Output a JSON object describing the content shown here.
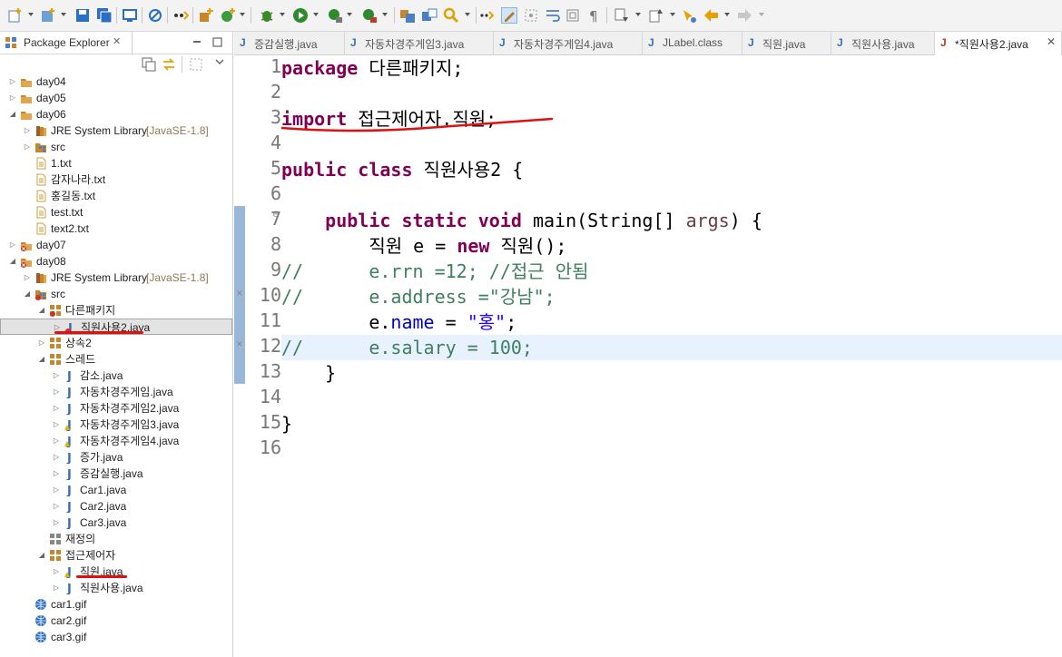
{
  "colors": {
    "keyword": "#7f0055",
    "comment": "#3f7f5f",
    "string": "#2a00ff",
    "field": "#0000c0",
    "annotation": "#e01010",
    "current_line": "#e8f2fe"
  },
  "explorer": {
    "title": "Package Explorer",
    "close": "✕",
    "tree": [
      {
        "label": "day04",
        "icon": "project-icon"
      },
      {
        "label": "day05",
        "icon": "project-icon"
      },
      {
        "label": "day06",
        "icon": "project-icon"
      },
      {
        "label": "JRE System Library",
        "suffix": "[JavaSE-1.8]",
        "icon": "library-icon"
      },
      {
        "label": "src",
        "icon": "source-folder-icon"
      },
      {
        "label": "1.txt",
        "icon": "text-file-icon"
      },
      {
        "label": "감자나라.txt",
        "icon": "text-file-icon"
      },
      {
        "label": "홍길동.txt",
        "icon": "text-file-icon"
      },
      {
        "label": "test.txt",
        "icon": "text-file-icon"
      },
      {
        "label": "text2.txt",
        "icon": "text-file-icon"
      },
      {
        "label": "day07",
        "icon": "project-error-icon"
      },
      {
        "label": "day08",
        "icon": "project-error-icon"
      },
      {
        "label": "JRE System Library",
        "suffix": "[JavaSE-1.8]",
        "icon": "library-icon"
      },
      {
        "label": "src",
        "icon": "source-folder-error-icon"
      },
      {
        "label": "다른패키지",
        "icon": "package-error-icon"
      },
      {
        "label": "직원사용2.java",
        "icon": "java-file-error-icon"
      },
      {
        "label": "상속2",
        "icon": "package-icon"
      },
      {
        "label": "스레드",
        "icon": "package-icon"
      },
      {
        "label": "감소.java",
        "icon": "java-file-icon"
      },
      {
        "label": "자동차경주게임.java",
        "icon": "java-file-icon"
      },
      {
        "label": "자동차경주게임2.java",
        "icon": "java-file-icon"
      },
      {
        "label": "자동차경주게임3.java",
        "icon": "java-file-warning-icon"
      },
      {
        "label": "자동차경주게임4.java",
        "icon": "java-file-warning-icon"
      },
      {
        "label": "증가.java",
        "icon": "java-file-icon"
      },
      {
        "label": "증감실행.java",
        "icon": "java-file-icon"
      },
      {
        "label": "Car1.java",
        "icon": "java-file-icon"
      },
      {
        "label": "Car2.java",
        "icon": "java-file-icon"
      },
      {
        "label": "Car3.java",
        "icon": "java-file-icon"
      },
      {
        "label": "재정의",
        "icon": "empty-package-icon"
      },
      {
        "label": "접근제어자",
        "icon": "package-icon"
      },
      {
        "label": "직원.java",
        "icon": "java-file-warning-icon"
      },
      {
        "label": "직원사용.java",
        "icon": "java-file-icon"
      },
      {
        "label": "car1.gif",
        "icon": "image-file-icon"
      },
      {
        "label": "car2.gif",
        "icon": "image-file-icon"
      },
      {
        "label": "car3.gif",
        "icon": "image-file-icon"
      }
    ]
  },
  "editor": {
    "tabs": [
      {
        "label": "증감실행.java"
      },
      {
        "label": "자동차경주게임3.java"
      },
      {
        "label": "자동차경주게임4.java"
      },
      {
        "label": "JLabel.class"
      },
      {
        "label": "직원.java"
      },
      {
        "label": "직원사용.java"
      },
      {
        "label": "*직원사용2.java",
        "close": "✕"
      }
    ],
    "line_numbers": [
      "1",
      "2",
      "3",
      "4",
      "5",
      "6",
      "7",
      "8",
      "9",
      "10",
      "11",
      "12",
      "13",
      "14",
      "15",
      "16"
    ],
    "code": {
      "l1_kw": "package",
      "l1_rest": " 다른패키지;",
      "l3_kw": "import",
      "l3_rest": " 접근제어자.직원;",
      "l5_kw1": "public",
      "l5_kw2": "class",
      "l5_rest": " 직원사용2 {",
      "l7_indent": "    ",
      "l7_kw1": "public",
      "l7_kw2": "static",
      "l7_kw3": "void",
      "l7_a": " main(String[] ",
      "l7_var": "args",
      "l7_b": ") {",
      "l8_a": "        직원 e = ",
      "l8_kw": "new",
      "l8_b": " 직원();",
      "l9": "//      e.rrn =12; //접근 안됨",
      "l10": "//      e.address =\"강남\";",
      "l11_a": "        e.",
      "l11_fld": "name",
      "l11_b": " = ",
      "l11_str": "\"홍\"",
      "l11_c": ";",
      "l12": "//      e.salary = 100;",
      "l13": "    }",
      "l15": "}"
    }
  }
}
